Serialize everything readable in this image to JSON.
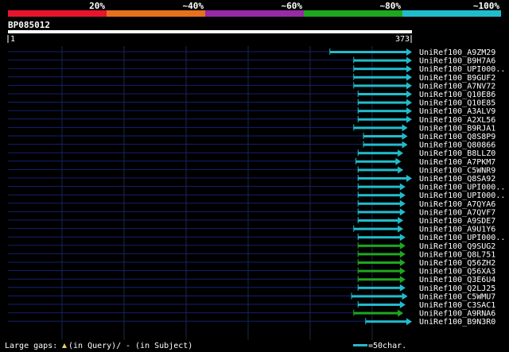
{
  "palette": {
    "background": "#000000",
    "text": "#ffffff",
    "grid": "#1a2850",
    "query_line": "#14206e",
    "hit_low": "#1fa71f",
    "hit_high": "#21bccc",
    "track_line": "#ffffff"
  },
  "legend_bar": {
    "labels": [
      "20%",
      "~40%",
      "~60%",
      "~80%",
      "~100%"
    ],
    "colors": [
      "#e8142d",
      "#e6711c",
      "#992aa6",
      "#1fa71f",
      "#21bccc"
    ]
  },
  "query": {
    "name": "BP085012",
    "start_label": "1",
    "end_label": "373",
    "length": 373
  },
  "hits": [
    {
      "name": "UniRef100_A9ZM29",
      "start": 298,
      "end": 373,
      "color": "#21bccc"
    },
    {
      "name": "UniRef100_B9H7A6",
      "start": 320,
      "end": 373,
      "color": "#21bccc"
    },
    {
      "name": "UniRef100_UPI000..",
      "start": 320,
      "end": 373,
      "color": "#21bccc"
    },
    {
      "name": "UniRef100_B9GUF2",
      "start": 320,
      "end": 373,
      "color": "#21bccc"
    },
    {
      "name": "UniRef100_A7NV72",
      "start": 320,
      "end": 373,
      "color": "#21bccc"
    },
    {
      "name": "UniRef100_Q10E86",
      "start": 324,
      "end": 373,
      "color": "#21bccc"
    },
    {
      "name": "UniRef100_Q10E85",
      "start": 324,
      "end": 373,
      "color": "#21bccc"
    },
    {
      "name": "UniRef100_A3ALV9",
      "start": 324,
      "end": 373,
      "color": "#21bccc"
    },
    {
      "name": "UniRef100_A2XL56",
      "start": 324,
      "end": 373,
      "color": "#21bccc"
    },
    {
      "name": "UniRef100_B9RJA1",
      "start": 320,
      "end": 369,
      "color": "#21bccc"
    },
    {
      "name": "UniRef100_Q8S8P9",
      "start": 329,
      "end": 369,
      "color": "#21bccc"
    },
    {
      "name": "UniRef100_Q80866",
      "start": 329,
      "end": 369,
      "color": "#21bccc"
    },
    {
      "name": "UniRef100_B8LLZ0",
      "start": 324,
      "end": 365,
      "color": "#21bccc"
    },
    {
      "name": "UniRef100_A7PKM7",
      "start": 322,
      "end": 363,
      "color": "#21bccc"
    },
    {
      "name": "UniRef100_C5WNR9",
      "start": 324,
      "end": 365,
      "color": "#21bccc"
    },
    {
      "name": "UniRef100_Q8SA92",
      "start": 324,
      "end": 373,
      "color": "#21bccc"
    },
    {
      "name": "UniRef100_UPI000..",
      "start": 324,
      "end": 367,
      "color": "#21bccc"
    },
    {
      "name": "UniRef100_UPI000..",
      "start": 324,
      "end": 367,
      "color": "#21bccc"
    },
    {
      "name": "UniRef100_A7QYA6",
      "start": 324,
      "end": 367,
      "color": "#21bccc"
    },
    {
      "name": "UniRef100_A7QVF7",
      "start": 324,
      "end": 367,
      "color": "#21bccc"
    },
    {
      "name": "UniRef100_A9SDE7",
      "start": 324,
      "end": 365,
      "color": "#21bccc"
    },
    {
      "name": "UniRef100_A9U1Y6",
      "start": 320,
      "end": 365,
      "color": "#21bccc"
    },
    {
      "name": "UniRef100_UPI000..",
      "start": 324,
      "end": 367,
      "color": "#21bccc"
    },
    {
      "name": "UniRef100_Q9SUG2",
      "start": 324,
      "end": 367,
      "color": "#1fa71f"
    },
    {
      "name": "UniRef100_Q8L751",
      "start": 324,
      "end": 367,
      "color": "#1fa71f"
    },
    {
      "name": "UniRef100_Q56ZH2",
      "start": 324,
      "end": 367,
      "color": "#1fa71f"
    },
    {
      "name": "UniRef100_Q56XA3",
      "start": 324,
      "end": 367,
      "color": "#1fa71f"
    },
    {
      "name": "UniRef100_Q3E6U4",
      "start": 324,
      "end": 367,
      "color": "#1fa71f"
    },
    {
      "name": "UniRef100_Q2LJ25",
      "start": 324,
      "end": 367,
      "color": "#21bccc"
    },
    {
      "name": "UniRef100_C5WMU7",
      "start": 318,
      "end": 369,
      "color": "#21bccc"
    },
    {
      "name": "UniRef100_C3SAC1",
      "start": 324,
      "end": 367,
      "color": "#21bccc"
    },
    {
      "name": "UniRef100_A9RNA6",
      "start": 320,
      "end": 365,
      "color": "#1fa71f"
    },
    {
      "name": "UniRef100_B9N3R0",
      "start": 331,
      "end": 373,
      "color": "#21bccc"
    }
  ],
  "footer": {
    "gaps_label": "Large gaps:",
    "gaps_query": "(in Query)/",
    "gaps_subject": "- (in Subject)",
    "scale_label": "=50char."
  }
}
